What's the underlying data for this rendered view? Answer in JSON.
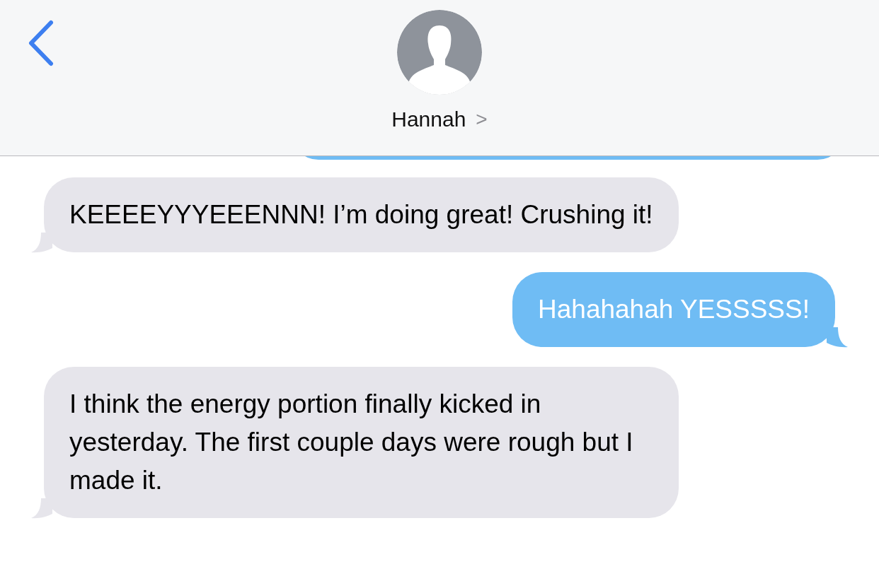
{
  "header": {
    "contact_name": "Hannah",
    "chevron": ">"
  },
  "messages": [
    {
      "kind": "received",
      "text": "KEEEEYYYEEENNN! I’m doing great! Crushing it!"
    },
    {
      "kind": "sent",
      "text": "Hahahahah YESSSSS!"
    },
    {
      "kind": "received",
      "text": "I think the energy portion finally kicked in yesterday. The first couple days were rough but I made it."
    }
  ]
}
